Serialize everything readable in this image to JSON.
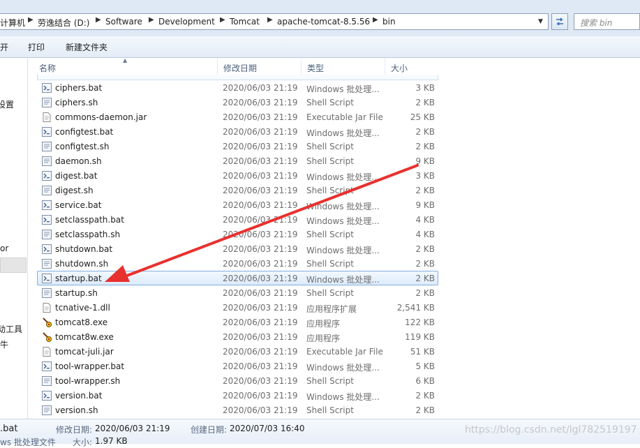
{
  "address_bar": {
    "breadcrumbs": [
      "计算机",
      "劳逸结合 (D:)",
      "Software",
      "Development",
      "Tomcat",
      "apache-tomcat-8.5.56",
      "bin"
    ],
    "search_placeholder": "搜索 bin"
  },
  "toolbar": {
    "open_label": "开",
    "print_label": "打印",
    "new_folder_label": "新建文件夹"
  },
  "nav_pane": {
    "items": [
      "设置",
      "or",
      "动工具",
      "牛"
    ]
  },
  "file_list": {
    "columns": {
      "name": "名称",
      "modified": "修改日期",
      "type": "类型",
      "size": "大小"
    },
    "files": [
      {
        "name": "ciphers.bat",
        "date": "2020/06/03 21:19",
        "type": "Windows 批处理...",
        "size": "3 KB",
        "icon": "batch-file-icon"
      },
      {
        "name": "ciphers.sh",
        "date": "2020/06/03 21:19",
        "type": "Shell Script",
        "size": "2 KB",
        "icon": "script-file-icon"
      },
      {
        "name": "commons-daemon.jar",
        "date": "2020/06/03 21:19",
        "type": "Executable Jar File",
        "size": "25 KB",
        "icon": "jar-file-icon"
      },
      {
        "name": "configtest.bat",
        "date": "2020/06/03 21:19",
        "type": "Windows 批处理...",
        "size": "2 KB",
        "icon": "batch-file-icon"
      },
      {
        "name": "configtest.sh",
        "date": "2020/06/03 21:19",
        "type": "Shell Script",
        "size": "2 KB",
        "icon": "script-file-icon"
      },
      {
        "name": "daemon.sh",
        "date": "2020/06/03 21:19",
        "type": "Shell Script",
        "size": "9 KB",
        "icon": "script-file-icon"
      },
      {
        "name": "digest.bat",
        "date": "2020/06/03 21:19",
        "type": "Windows 批处理...",
        "size": "3 KB",
        "icon": "batch-file-icon"
      },
      {
        "name": "digest.sh",
        "date": "2020/06/03 21:19",
        "type": "Shell Script",
        "size": "2 KB",
        "icon": "script-file-icon"
      },
      {
        "name": "service.bat",
        "date": "2020/06/03 21:19",
        "type": "Windows 批处理...",
        "size": "9 KB",
        "icon": "batch-file-icon"
      },
      {
        "name": "setclasspath.bat",
        "date": "2020/06/03 21:19",
        "type": "Windows 批处理...",
        "size": "4 KB",
        "icon": "batch-file-icon"
      },
      {
        "name": "setclasspath.sh",
        "date": "2020/06/03 21:19",
        "type": "Shell Script",
        "size": "4 KB",
        "icon": "script-file-icon"
      },
      {
        "name": "shutdown.bat",
        "date": "2020/06/03 21:19",
        "type": "Windows 批处理...",
        "size": "2 KB",
        "icon": "batch-file-icon"
      },
      {
        "name": "shutdown.sh",
        "date": "2020/06/03 21:19",
        "type": "Shell Script",
        "size": "2 KB",
        "icon": "script-file-icon"
      },
      {
        "name": "startup.bat",
        "date": "2020/06/03 21:19",
        "type": "Windows 批处理...",
        "size": "2 KB",
        "icon": "batch-file-icon",
        "selected": true
      },
      {
        "name": "startup.sh",
        "date": "2020/06/03 21:19",
        "type": "Shell Script",
        "size": "2 KB",
        "icon": "script-file-icon"
      },
      {
        "name": "tcnative-1.dll",
        "date": "2020/06/03 21:19",
        "type": "应用程序扩展",
        "size": "2,541 KB",
        "icon": "dll-file-icon"
      },
      {
        "name": "tomcat8.exe",
        "date": "2020/06/03 21:19",
        "type": "应用程序",
        "size": "122 KB",
        "icon": "tomcat-exe-icon"
      },
      {
        "name": "tomcat8w.exe",
        "date": "2020/06/03 21:19",
        "type": "应用程序",
        "size": "119 KB",
        "icon": "tomcat-exe-icon"
      },
      {
        "name": "tomcat-juli.jar",
        "date": "2020/06/03 21:19",
        "type": "Executable Jar File",
        "size": "51 KB",
        "icon": "jar-file-icon"
      },
      {
        "name": "tool-wrapper.bat",
        "date": "2020/06/03 21:19",
        "type": "Windows 批处理...",
        "size": "5 KB",
        "icon": "batch-file-icon"
      },
      {
        "name": "tool-wrapper.sh",
        "date": "2020/06/03 21:19",
        "type": "Shell Script",
        "size": "6 KB",
        "icon": "script-file-icon"
      },
      {
        "name": "version.bat",
        "date": "2020/06/03 21:19",
        "type": "Windows 批处理...",
        "size": "2 KB",
        "icon": "batch-file-icon"
      },
      {
        "name": "version.sh",
        "date": "2020/06/03 21:19",
        "type": "Shell Script",
        "size": "2 KB",
        "icon": "script-file-icon"
      }
    ]
  },
  "details_pane": {
    "file_name": ".bat",
    "file_type": "ws 批处理文件",
    "modified_label": "修改日期:",
    "modified_value": "2020/06/03 21:19",
    "created_label": "创建日期:",
    "created_value": "2020/07/03 16:40",
    "size_label": "大小:",
    "size_value": "1.97 KB"
  },
  "watermark": "https://blog.csdn.net/lgl782519197",
  "colors": {
    "annotation_arrow": "#e8312f",
    "selection_border": "#84acdd",
    "header_text": "#4c607a"
  }
}
